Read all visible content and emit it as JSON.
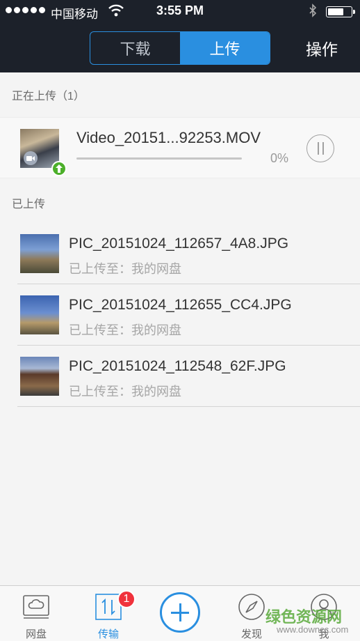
{
  "status_bar": {
    "carrier": "中国移动",
    "time": "3:55 PM"
  },
  "header": {
    "tabs": [
      {
        "label": "下载",
        "active": false
      },
      {
        "label": "上传",
        "active": true
      }
    ],
    "action_label": "操作",
    "accent_color": "#2a8fe0"
  },
  "uploading": {
    "section_label": "正在上传（1）",
    "item": {
      "name": "Video_20151...92253.MOV",
      "progress": 0,
      "progress_text": "0%",
      "icons": [
        "video-camera-icon",
        "upload-arrow-icon",
        "pause-icon"
      ]
    }
  },
  "uploaded": {
    "section_label": "已上传",
    "items": [
      {
        "name": "PIC_20151024_112657_4A8.JPG",
        "dest": "已上传至：我的网盘"
      },
      {
        "name": "PIC_20151024_112655_CC4.JPG",
        "dest": "已上传至：我的网盘"
      },
      {
        "name": "PIC_20151024_112548_62F.JPG",
        "dest": "已上传至：我的网盘"
      }
    ]
  },
  "tabbar": {
    "items": [
      {
        "label": "网盘",
        "icon": "cloud-drive-icon"
      },
      {
        "label": "传输",
        "icon": "transfer-arrows-icon",
        "active": true,
        "badge": "1"
      },
      {
        "label": "",
        "icon": "plus-icon"
      },
      {
        "label": "发现",
        "icon": "compass-icon"
      },
      {
        "label": "我",
        "icon": "person-icon"
      }
    ]
  },
  "watermark": {
    "text": "绿色资源网",
    "url": "www.downcc.com"
  }
}
